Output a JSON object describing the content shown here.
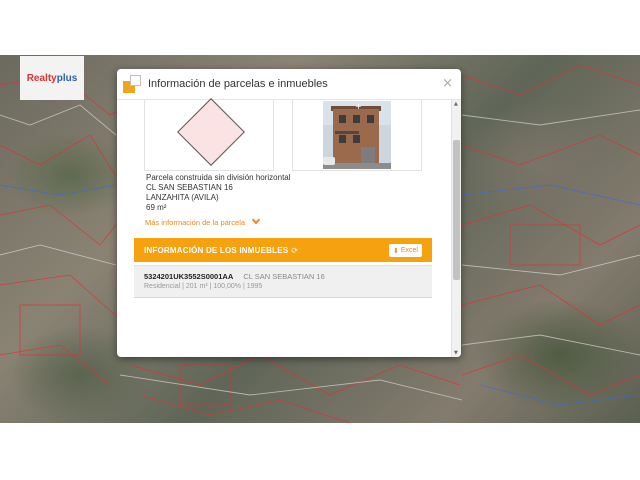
{
  "logo": {
    "brand_primary": "Realty",
    "brand_secondary": "plus"
  },
  "panel": {
    "title": "Información de parcelas e inmuebles",
    "close_label": "×"
  },
  "parcel": {
    "description": "Parcela construida sin división horizontal",
    "address": "CL SAN SEBASTIAN 16",
    "locality": "LANZAHITA (AVILA)",
    "area": "69 m²",
    "more_info_link": "Más información de la parcela"
  },
  "properties": {
    "header_title": "INFORMACIÓN DE LOS INMUEBLES",
    "excel_label": "Excel",
    "items": [
      {
        "reference": "5324201UK3552S0001AA",
        "address": "CL SAN SEBASTIAN 16",
        "details": "Residencial | 201 m² | 100,00% | 1995"
      }
    ]
  },
  "colors": {
    "accent": "#f5a20e",
    "link": "#e9891a"
  }
}
